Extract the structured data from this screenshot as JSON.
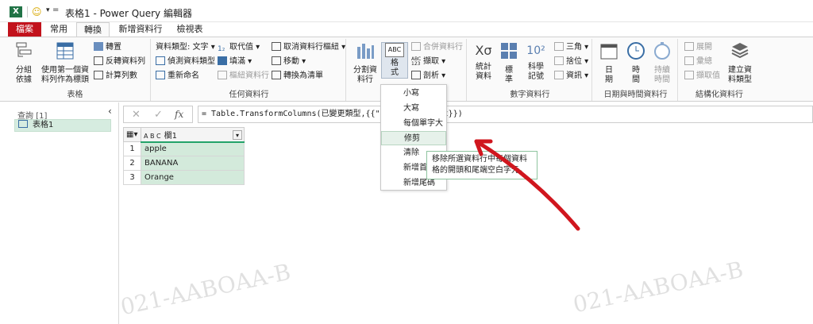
{
  "window": {
    "title": "表格1 - Power Query 編輯器",
    "app_letter": "X"
  },
  "tabs": [
    "檔案",
    "常用",
    "轉換",
    "新增資料行",
    "檢視表"
  ],
  "ribbon": {
    "table_group": {
      "label": "表格",
      "group_by": "分組\n依據",
      "use_first_row": "使用第一個資\n料列作為標頭",
      "transpose": "轉置",
      "reverse_rows": "反轉資料列",
      "count_rows": "計算列數"
    },
    "any_column_group": {
      "label": "任何資料行",
      "data_type": "資料類型: 文字",
      "detect_type": "偵測資料類型",
      "rename": "重新命名",
      "replace_values": "取代值",
      "fill": "填滿",
      "pivot": "樞紐資料行",
      "unpivot": "取消資料行樞紐",
      "move": "移動",
      "convert_to_list": "轉換為清單"
    },
    "text_group": {
      "split_column": "分割資\n料行",
      "format": "格\n式",
      "merge_columns": "合併資料行",
      "extract": "擷取",
      "parse": "剖析",
      "abc_icon": "ABC",
      "abc123_icon": "ABC\n123"
    },
    "number_group": {
      "label": "數字資料行",
      "statistics": "統計\n資料",
      "standard": "標\n準",
      "scientific": "科學\n記號",
      "trig": "三角",
      "rounding": "捨位",
      "info": "資訊",
      "sci_icon": "10²"
    },
    "datetime_group": {
      "label": "日期與時間資料行",
      "date": "日\n期",
      "time": "時\n間",
      "duration": "持續\n時間"
    },
    "structured_group": {
      "label": "結構化資料行",
      "expand": "展開",
      "aggregate": "彙總",
      "extract_values": "擷取值",
      "create_type": "建立資\n料類型"
    }
  },
  "query_pane": {
    "header": "查詢 [1]",
    "items": [
      "表格1"
    ]
  },
  "formula": "= Table.TransformColumns(已變更類型,{{\"欄1\", Text.Trim, type text}})",
  "formula_visible_left": "= Table.TransformColumns(已變更類型,{{\"欄1\",",
  "formula_visible_right": "t}})",
  "grid": {
    "column": "欄1",
    "type_icon": "A B C",
    "rows": [
      {
        "n": "1",
        "v": "apple"
      },
      {
        "n": "2",
        "v": "BANANA"
      },
      {
        "n": "3",
        "v": "Orange"
      }
    ]
  },
  "format_menu": {
    "items": [
      "小寫",
      "大寫",
      "每個單字大寫",
      "修剪",
      "清除",
      "新增首碼",
      "新增尾碼"
    ],
    "highlighted": "修剪"
  },
  "tooltip": "移除所選資料行中每個資料格的開頭和尾端空白字元。",
  "watermark": "021-AABOAA-B",
  "colors": {
    "accent": "#217346",
    "file_tab": "#c2121c",
    "arrow": "#d0161e",
    "selected_cell": "#d3eadb"
  }
}
